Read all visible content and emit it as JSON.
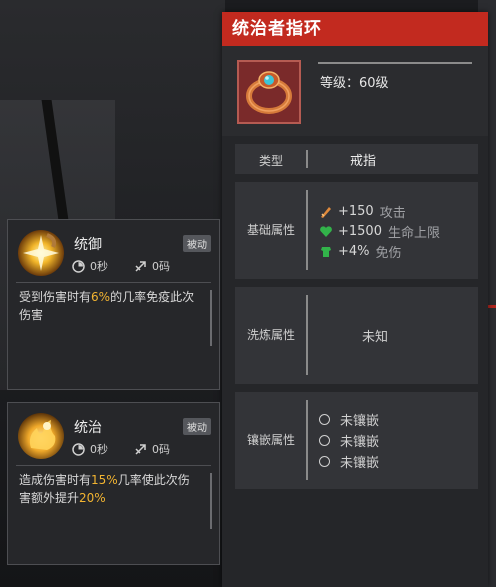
{
  "item": {
    "title": "统治者指环",
    "level": "等级：60级",
    "type_label": "类型",
    "type_value": "戒指",
    "base_label": "基础属性",
    "base_attrs": [
      {
        "value": "+150",
        "name": "攻击",
        "icon": "attack-icon",
        "color": "#e08a3c"
      },
      {
        "value": "+1500",
        "name": "生命上限",
        "icon": "heart-icon",
        "color": "#32b34a"
      },
      {
        "value": "+4%",
        "name": "免伤",
        "icon": "armor-icon",
        "color": "#32b34a"
      }
    ],
    "wash_label": "洗炼属性",
    "wash_value": "未知",
    "gem_label": "镶嵌属性",
    "gem_slots": [
      "未镶嵌",
      "未镶嵌",
      "未镶嵌"
    ]
  },
  "skills": [
    {
      "name": "统御",
      "badge": "被动",
      "cooldown": "0秒",
      "range": "0码",
      "desc_parts": [
        "受到伤害时有",
        "6%",
        "的几率免疫此次伤害"
      ]
    },
    {
      "name": "统治",
      "badge": "被动",
      "cooldown": "0秒",
      "range": "0码",
      "desc_parts": [
        "造成伤害时有",
        "15%",
        "几率使此次伤害额外提升",
        "20%"
      ]
    }
  ],
  "colors": {
    "title_bar": "#c22a1f",
    "highlight": "#f2b431"
  }
}
